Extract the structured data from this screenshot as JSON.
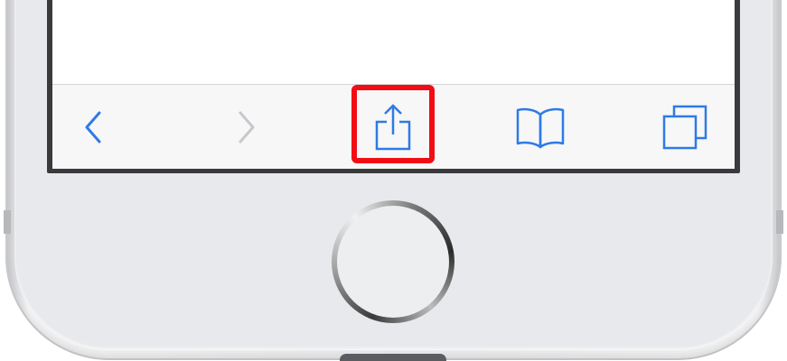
{
  "device": {
    "model": "iPhone",
    "colors": {
      "chassis": "#ececee",
      "screen_bezel": "#3a3a3c",
      "toolbar_bg": "#f7f7f7",
      "icon_active": "#2f7ae5",
      "icon_disabled": "#c7c7cc",
      "highlight": "#f20d14"
    }
  },
  "toolbar": {
    "buttons": [
      {
        "name": "back",
        "icon": "chevron-left-icon",
        "enabled": true
      },
      {
        "name": "forward",
        "icon": "chevron-right-icon",
        "enabled": false
      },
      {
        "name": "share",
        "icon": "share-icon",
        "enabled": true,
        "highlighted": true
      },
      {
        "name": "bookmarks",
        "icon": "book-icon",
        "enabled": true
      },
      {
        "name": "tabs",
        "icon": "tabs-icon",
        "enabled": true
      }
    ]
  },
  "hardware": {
    "home_button": "home-button"
  }
}
